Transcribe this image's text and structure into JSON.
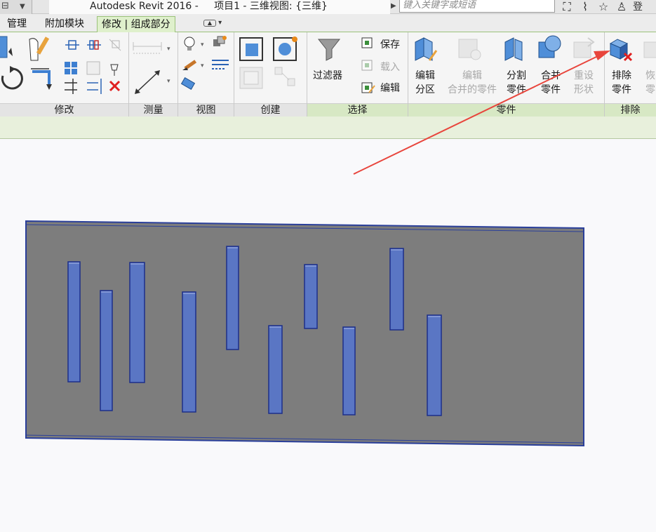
{
  "titlebar": {
    "app_title": "Autodesk Revit 2016 -     项目1 - 三维视图: {三维}",
    "search_placeholder": "键入关键字或短语",
    "login_label": "登"
  },
  "tabs": [
    {
      "label": "管理"
    },
    {
      "label": "附加模块"
    },
    {
      "label": "修改 | 组成部分"
    }
  ],
  "ribbon": {
    "panels": {
      "modify": "修改",
      "measure": "测量",
      "view": "视图",
      "create": "创建",
      "select": "选择",
      "parts": "零件",
      "exclude": "排除"
    },
    "filter_label": "过滤器",
    "save_label": "保存",
    "load_label": "载入",
    "edit_label": "编辑",
    "edit_division": [
      "编辑",
      "分区"
    ],
    "edit_merged": [
      "编辑",
      "合并的零件"
    ],
    "divide_parts": [
      "分割",
      "零件"
    ],
    "merge_parts": [
      "合并",
      "零件"
    ],
    "reset_shape": [
      "重设",
      "形状"
    ],
    "exclude_parts": [
      "排除",
      "零件"
    ],
    "restore_parts": [
      "恢",
      "零"
    ]
  },
  "colors": {
    "accent_green": "#9bc27a",
    "part_blue": "#5a76c4",
    "wall_gray": "#7d7d7d",
    "arrow_red": "#e8453c"
  }
}
